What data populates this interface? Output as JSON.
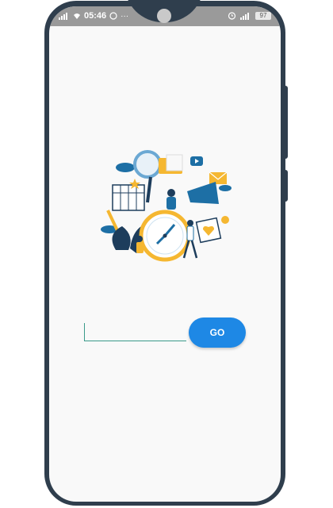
{
  "status_bar": {
    "time": "05:46",
    "left_icons": [
      "signal-icon",
      "wifi-icon",
      "whatsapp-icon",
      "more-icon"
    ],
    "right_icons": [
      "alarm-icon",
      "4g-signal-icon"
    ],
    "battery": "97"
  },
  "main": {
    "input": {
      "value": "",
      "placeholder": ""
    },
    "go_button_label": "GO"
  },
  "colors": {
    "accent": "#1e88e5",
    "frame": "#2f3e4d",
    "input_line": "#3a9a8a",
    "illustration_blue": "#1d6fa5",
    "illustration_yellow": "#f5b731"
  }
}
